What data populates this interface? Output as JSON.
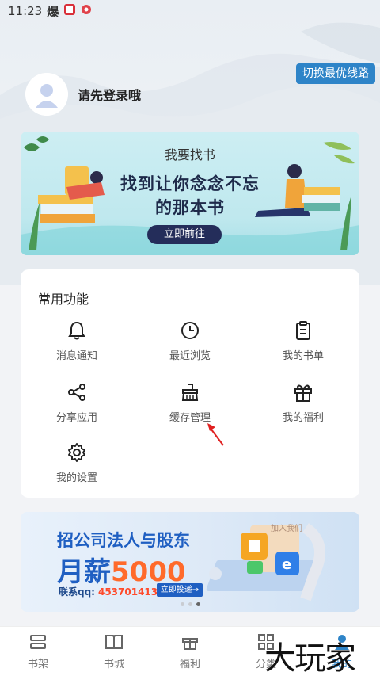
{
  "status_bar": {
    "time": "11:23"
  },
  "header": {
    "switch_label": "切换最优线路",
    "login_text": "请先登录哦"
  },
  "banner_find_book": {
    "title": "我要找书",
    "line1": "找到让你念念不忘",
    "line2": "的那本书",
    "button": "立即前往"
  },
  "functions": {
    "title": "常用功能",
    "items": [
      {
        "label": "消息通知",
        "icon": "bell-icon"
      },
      {
        "label": "最近浏览",
        "icon": "clock-icon"
      },
      {
        "label": "我的书单",
        "icon": "clipboard-icon"
      },
      {
        "label": "分享应用",
        "icon": "share-icon"
      },
      {
        "label": "缓存管理",
        "icon": "broom-icon"
      },
      {
        "label": "我的福利",
        "icon": "gift-icon"
      },
      {
        "label": "我的设置",
        "icon": "gear-icon"
      }
    ]
  },
  "banner_ad": {
    "line1": "招公司法人与股东",
    "line2_prefix": "月薪",
    "line2_number": "5000",
    "contact_label": "联系qq:",
    "contact_qq": "453701413",
    "button": "立即投递→",
    "join": "加入我们"
  },
  "tabbar": {
    "items": [
      {
        "label": "书架",
        "icon": "bookshelf-icon"
      },
      {
        "label": "书城",
        "icon": "book-icon"
      },
      {
        "label": "福利",
        "icon": "gift-icon"
      },
      {
        "label": "分类",
        "icon": "grid-icon"
      },
      {
        "label": "我的",
        "icon": "user-icon"
      }
    ]
  },
  "watermark": "大玩家",
  "colors": {
    "accent": "#2e84c8",
    "dark_button": "#242d5a",
    "ad_blue": "#1f5fc2",
    "ad_orange": "#ff6a2b"
  }
}
